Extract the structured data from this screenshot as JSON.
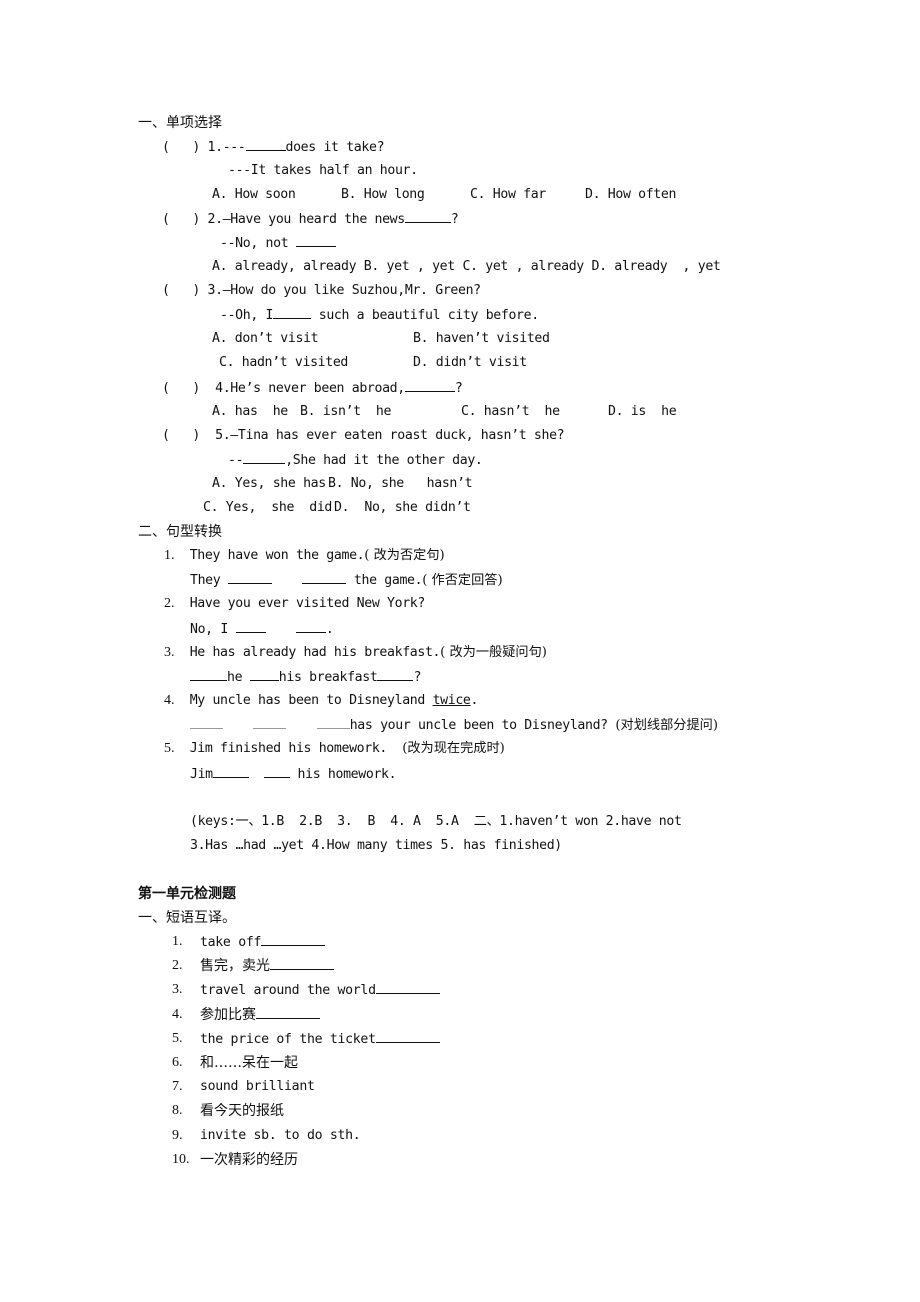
{
  "section1": {
    "title": "一、单项选择",
    "q1": {
      "prompt_pre": "(   ) 1.---",
      "prompt_post": "does it take?",
      "answer": "---It takes half an hour.",
      "options": [
        "A. How soon",
        "B. How long",
        "C. How far",
        "D. How often"
      ]
    },
    "q2": {
      "prompt": "(   ) 2.—Have you heard the news",
      "prompt_end": "?",
      "reply": "--No, not",
      "options_line": "A. already, already B. yet , yet C. yet , already D. already  , yet"
    },
    "q3": {
      "prompt": "(   ) 3.—How do you like Suzhou,Mr. Green?",
      "reply_pre": "--Oh, I",
      "reply_post": " such a beautiful city before.",
      "options": [
        "A. don’t visit",
        "B. haven’t visited",
        "C. hadn’t visited",
        "D. didn’t visit"
      ]
    },
    "q4": {
      "prompt": "(   )  4.He’s never been abroad,",
      "prompt_end": "?",
      "options": [
        "A. has  he",
        "B. isn’t  he",
        "C. hasn’t  he",
        "D. is  he"
      ]
    },
    "q5": {
      "prompt": "(   )  5.—Tina has ever eaten roast duck, hasn’t she?",
      "reply_pre": "--",
      "reply_post": ",She had it the other day.",
      "options": [
        "A. Yes, she has",
        "B. No, she   hasn’t",
        "C. Yes,  she  did",
        "D.  No, she didn’t"
      ]
    }
  },
  "section2": {
    "title": "二、句型转换",
    "items": [
      {
        "num": "1.",
        "line1": "They have won the game.",
        "note1": "( 改为否定句)",
        "line2_pre": "They",
        "line2_post": " the game.",
        "note2": "( 作否定回答)"
      },
      {
        "num": "2.",
        "line1": "Have you ever visited New York?",
        "line2_pre": "No, I",
        "line2_post": "."
      },
      {
        "num": "3.",
        "line1": "He has already had his breakfast.",
        "note1": "( 改为一般疑问句)",
        "line2_a": "he",
        "line2_b": "his breakfast",
        "line2_end": "?"
      },
      {
        "num": "4.",
        "line1_pre": "My uncle has been to Disneyland ",
        "line1_underlined": "twice",
        "line1_end": ".",
        "line2_post": "has your uncle been to Disneyland?",
        "note2": "(对划线部分提问)"
      },
      {
        "num": "5.",
        "line1": "Jim finished his homework.",
        "note1": "(改为现在完成时)",
        "line2_pre": "Jim",
        "line2_post": " his homework."
      }
    ]
  },
  "keys": {
    "line1": "(keys:一、1.B  2.B  3.  B  4. A  5.A  二、1.haven’t won 2.have not",
    "line2": "3.Has …had …yet 4.How many times 5. has finished)"
  },
  "unit_test": {
    "title": "第一单元检测题",
    "subtitle": "一、短语互译。",
    "items": [
      {
        "num": "1.",
        "text": "take off",
        "blank": true,
        "latin": true
      },
      {
        "num": "2.",
        "text": "售完，卖光",
        "blank": true,
        "latin": false
      },
      {
        "num": "3.",
        "text": "travel around the world",
        "blank": true,
        "latin": true
      },
      {
        "num": "4.",
        "text": "参加比赛",
        "blank": true,
        "latin": false
      },
      {
        "num": "5.",
        "text": "the price of the ticket",
        "blank": true,
        "latin": true
      },
      {
        "num": "6.",
        "text": "和……呆在一起",
        "blank": false,
        "latin": false
      },
      {
        "num": "7.",
        "text": "sound brilliant",
        "blank": false,
        "latin": true
      },
      {
        "num": "8.",
        "text": "看今天的报纸",
        "blank": false,
        "latin": false
      },
      {
        "num": "9.",
        "text": "invite sb. to do sth.",
        "blank": false,
        "latin": true
      },
      {
        "num": "10.",
        "text": "一次精彩的经历",
        "blank": false,
        "latin": false
      }
    ]
  }
}
